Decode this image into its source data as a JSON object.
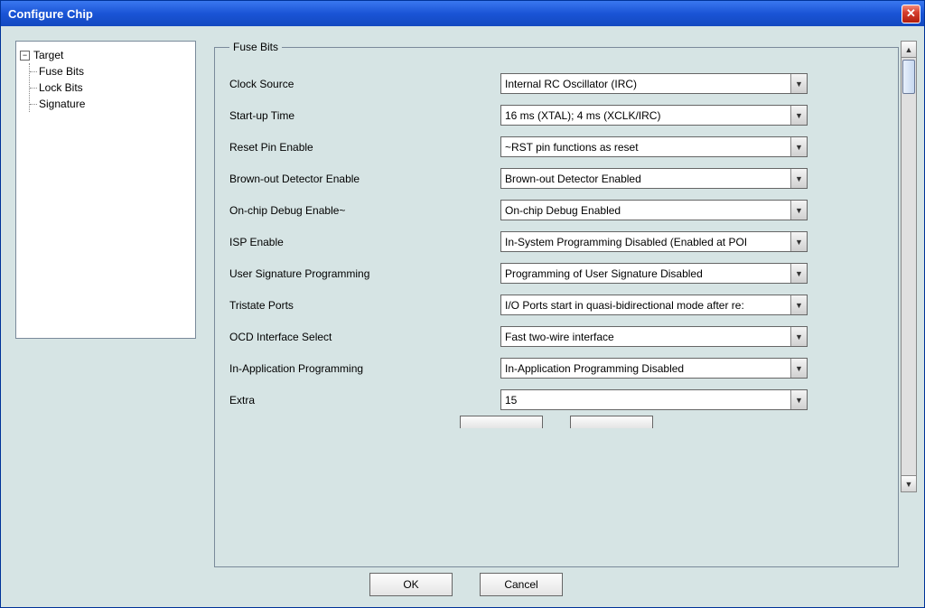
{
  "window": {
    "title": "Configure Chip"
  },
  "tree": {
    "root": "Target",
    "items": [
      "Fuse Bits",
      "Lock Bits",
      "Signature"
    ]
  },
  "fieldset": {
    "legend": "Fuse Bits"
  },
  "rows": [
    {
      "label": "Clock Source",
      "value": "Internal RC Oscillator (IRC)"
    },
    {
      "label": "Start-up Time",
      "value": "16 ms (XTAL); 4 ms (XCLK/IRC)"
    },
    {
      "label": "Reset Pin Enable",
      "value": "~RST pin functions as reset"
    },
    {
      "label": "Brown-out Detector Enable",
      "value": "Brown-out Detector Enabled"
    },
    {
      "label": "On-chip Debug Enable~",
      "value": "On-chip Debug Enabled"
    },
    {
      "label": "ISP Enable",
      "value": "In-System Programming Disabled (Enabled at POI"
    },
    {
      "label": "User Signature Programming",
      "value": "Programming of User Signature Disabled"
    },
    {
      "label": "Tristate Ports",
      "value": "I/O Ports start in quasi-bidirectional mode after re:"
    },
    {
      "label": "OCD Interface Select",
      "value": "Fast two-wire interface"
    },
    {
      "label": "In-Application Programming",
      "value": "In-Application Programming Disabled"
    },
    {
      "label": "Extra",
      "value": "15"
    }
  ],
  "buttons": {
    "ok": "OK",
    "cancel": "Cancel"
  },
  "glyphs": {
    "minus": "−",
    "down": "▼",
    "up": "▲",
    "x": "✕"
  }
}
